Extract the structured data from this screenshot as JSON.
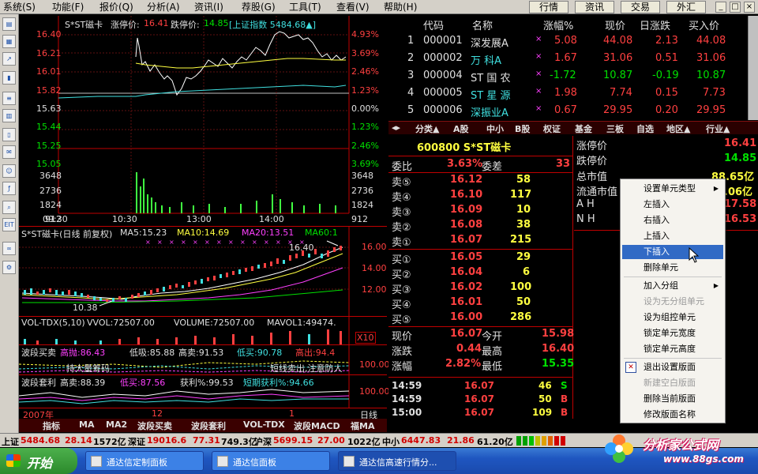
{
  "menu": {
    "items": [
      "系统(S)",
      "功能(F)",
      "报价(Q)",
      "分析(A)",
      "资讯(I)",
      "荐股(G)",
      "工具(T)",
      "查看(V)",
      "帮助(H)"
    ],
    "right_buttons": [
      "行情",
      "资讯",
      "交易",
      "外汇"
    ]
  },
  "intraday": {
    "stock": "S*ST磁卡",
    "limit_up_label": "涨停价:",
    "limit_up": "16.41",
    "limit_down_label": "跌停价:",
    "limit_down": "14.85",
    "index_label": "[上证指数 5484.68▲]",
    "left_axis": [
      "16.40",
      "16.21",
      "16.01",
      "15.82",
      "15.63",
      "15.44",
      "15.25",
      "15.05",
      "3648",
      "2736",
      "1824",
      "912"
    ],
    "right_axis": [
      "4.93%",
      "3.69%",
      "2.46%",
      "1.23%",
      "0.00%",
      "1.23%",
      "2.46%",
      "3.69%",
      "3648",
      "2736",
      "1824",
      "912"
    ],
    "time_axis": [
      "09:30",
      "10:30",
      "13:00",
      "14:00"
    ]
  },
  "kline": {
    "title": "S*ST磁卡(日线 前复权)",
    "ma5": "MA5:15.23",
    "ma10": "MA10:14.69",
    "ma20": "MA20:13.51",
    "ma60": "MA60:1",
    "high_mark": "16.40",
    "low_mark": "10.38",
    "right_axis": [
      "16.00",
      "14.00",
      "12.00"
    ]
  },
  "volume": {
    "title": "VOL-TDX(5,10)",
    "vvol": "VVOL:72507.00",
    "volume": "VOLUME:72507.00",
    "mavol": "MAVOL1:49474.",
    "x10": "X10"
  },
  "ind1": {
    "name": "波段买卖",
    "a": "高抛:86.43",
    "b": "低吸:85.88",
    "c": "高卖:91.53",
    "d": "低买:90.78",
    "e": "高出:94.4",
    "axis": "100.00",
    "text1": "持大量筹码",
    "text2": "短线卖出,注意防人"
  },
  "ind2": {
    "name": "波段套利",
    "a": "高卖:88.39",
    "b": "低买:87.56",
    "c": "获利%:99.53",
    "d": "短期获利%:94.66",
    "axis1": "100.00",
    "axis2": "0.00"
  },
  "date_axis": {
    "year": "2007年",
    "m12": "12",
    "m1": "1",
    "label": "日线"
  },
  "bottom_tabs": [
    "指标",
    "MA",
    "MA2",
    "波段买卖",
    "波段套利",
    "VOL-TDX",
    "波段MACD",
    "福MA"
  ],
  "quote_table": {
    "headers": [
      "代码",
      "名称",
      "涨幅%",
      "现价",
      "日涨跌",
      "买入价"
    ],
    "rows": [
      {
        "no": "1",
        "code": "000001",
        "name": "深发展A",
        "chg": "5.08",
        "price": "44.08",
        "diff": "2.13",
        "bid": "44.08"
      },
      {
        "no": "2",
        "code": "000002",
        "name": "万  科A",
        "chg": "1.67",
        "price": "31.06",
        "diff": "0.51",
        "bid": "31.06"
      },
      {
        "no": "3",
        "code": "000004",
        "name": "ST 国 农",
        "chg": "-1.72",
        "price": "10.87",
        "diff": "-0.19",
        "bid": "10.87"
      },
      {
        "no": "4",
        "code": "000005",
        "name": "ST 星 源",
        "chg": "1.98",
        "price": "7.74",
        "diff": "0.15",
        "bid": "7.73"
      },
      {
        "no": "5",
        "code": "000006",
        "name": "深振业A",
        "chg": "0.67",
        "price": "29.95",
        "diff": "0.20",
        "bid": "29.95"
      }
    ]
  },
  "sector_tabs": [
    "分类▲",
    "A股",
    "中小",
    "B股",
    "权证",
    "基金",
    "三板",
    "自选",
    "地区▲",
    "行业▲"
  ],
  "orderbook": {
    "title": "600800 S*ST磁卡",
    "wb_label": "委比",
    "wb": "3.63%",
    "wc_label": "委差",
    "wc": "33",
    "sells": [
      {
        "label": "卖⑤",
        "price": "16.12",
        "vol": "58"
      },
      {
        "label": "卖④",
        "price": "16.10",
        "vol": "117"
      },
      {
        "label": "卖③",
        "price": "16.09",
        "vol": "10"
      },
      {
        "label": "卖②",
        "price": "16.08",
        "vol": "38"
      },
      {
        "label": "卖①",
        "price": "16.07",
        "vol": "215"
      }
    ],
    "buys": [
      {
        "label": "买①",
        "price": "16.05",
        "vol": "29"
      },
      {
        "label": "买②",
        "price": "16.04",
        "vol": "6"
      },
      {
        "label": "买③",
        "price": "16.02",
        "vol": "100"
      },
      {
        "label": "买④",
        "price": "16.01",
        "vol": "50"
      },
      {
        "label": "买⑤",
        "price": "16.00",
        "vol": "286"
      }
    ],
    "now_label": "现价",
    "now": "16.07",
    "open_label": "今开",
    "open": "15.98",
    "chg_label": "涨跌",
    "chg": "0.44",
    "high_label": "最高",
    "high": "16.40",
    "pct_label": "涨幅",
    "pct": "2.82%",
    "low_label": "最低",
    "low": "15.35"
  },
  "ticks": [
    {
      "time": "14:59",
      "price": "16.07",
      "vol": "46",
      "side": "S"
    },
    {
      "time": "14:59",
      "price": "16.07",
      "vol": "50",
      "side": "B"
    },
    {
      "time": "15:00",
      "price": "16.07",
      "vol": "109",
      "side": "B"
    }
  ],
  "infopanel": {
    "limit_up_label": "涨停价",
    "limit_up": "16.41",
    "limit_down_label": "跌停价",
    "limit_down": "14.85",
    "mktcap_label": "总市值",
    "mktcap": "88.65亿",
    "float_label": "流通市值",
    "float": ".06亿",
    "ah_label": "A H",
    "ah": "17.58",
    "nh_label": "N H",
    "nh": "16.53"
  },
  "context_menu": {
    "items": [
      "设置单元类型",
      "左插入",
      "右插入",
      "上插入",
      "下插入",
      "删除单元",
      "加入分组",
      "设为无分组单元",
      "设为组控单元",
      "锁定单元宽度",
      "锁定单元高度",
      "退出设置版面",
      "新建空白版面",
      "删除当前版面",
      "修改版面名称"
    ]
  },
  "statusbar": {
    "sh_label": "上证",
    "sh_val": "5484.68",
    "sh_chg": "28.14",
    "sh_amt": "1572亿",
    "sz_label": "深证",
    "sz_val": "19016.6",
    "sz_chg": "77.31",
    "sz_amt": "749.3亿",
    "hs_label": "沪深",
    "hs_val": "5699.15",
    "hs_chg": "27.00",
    "hs_amt": "1022亿",
    "zx_label": "中小",
    "zx_val": "6447.83",
    "zx_chg": "21.86",
    "zx_amt": "61.20亿"
  },
  "taskbar": {
    "start": "开始",
    "tasks": [
      "通达信定制面板",
      "通达信面板",
      "通达信高速行情分..."
    ]
  },
  "logo": {
    "title": "分析家公式网",
    "url": "www.88gs.com"
  },
  "colors": {
    "up": "#ff4040",
    "down": "#00e000",
    "accent": "#ffff40",
    "highlight": "#316ac5"
  }
}
